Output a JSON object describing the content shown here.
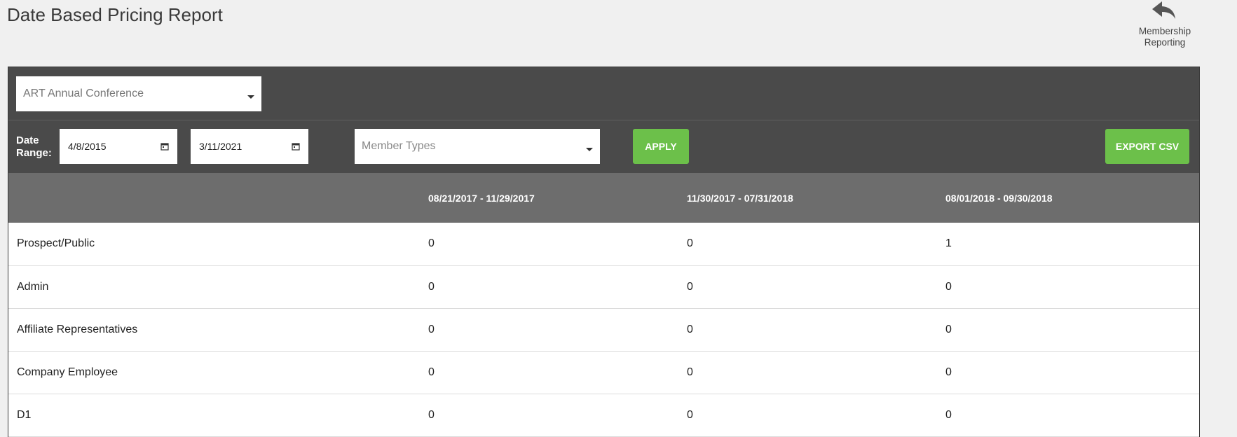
{
  "page": {
    "title": "Date Based Pricing Report"
  },
  "back_link": {
    "label_line1": "Membership",
    "label_line2": "Reporting",
    "icon": "reply-arrow-icon"
  },
  "filters": {
    "event_select": {
      "value": "ART Annual Conference"
    },
    "date_range_label_line1": "Date",
    "date_range_label_line2": "Range:",
    "start_date": "4/8/2015",
    "end_date": "3/11/2021",
    "member_types": {
      "placeholder": "Member Types"
    },
    "apply_label": "APPLY",
    "export_label": "EXPORT CSV"
  },
  "table": {
    "headers": [
      "",
      "08/21/2017 - 11/29/2017",
      "11/30/2017 - 07/31/2018",
      "08/01/2018 - 09/30/2018"
    ],
    "rows": [
      {
        "label": "Prospect/Public",
        "values": [
          "0",
          "0",
          "1"
        ]
      },
      {
        "label": "Admin",
        "values": [
          "0",
          "0",
          "0"
        ]
      },
      {
        "label": "Affiliate Representatives",
        "values": [
          "0",
          "0",
          "0"
        ]
      },
      {
        "label": "Company Employee",
        "values": [
          "0",
          "0",
          "0"
        ]
      },
      {
        "label": "D1",
        "values": [
          "0",
          "0",
          "0"
        ]
      }
    ]
  },
  "colors": {
    "accent_green": "#6cc04a",
    "panel_dark": "#4a4a4a",
    "header_gray": "#6d6d6d"
  }
}
